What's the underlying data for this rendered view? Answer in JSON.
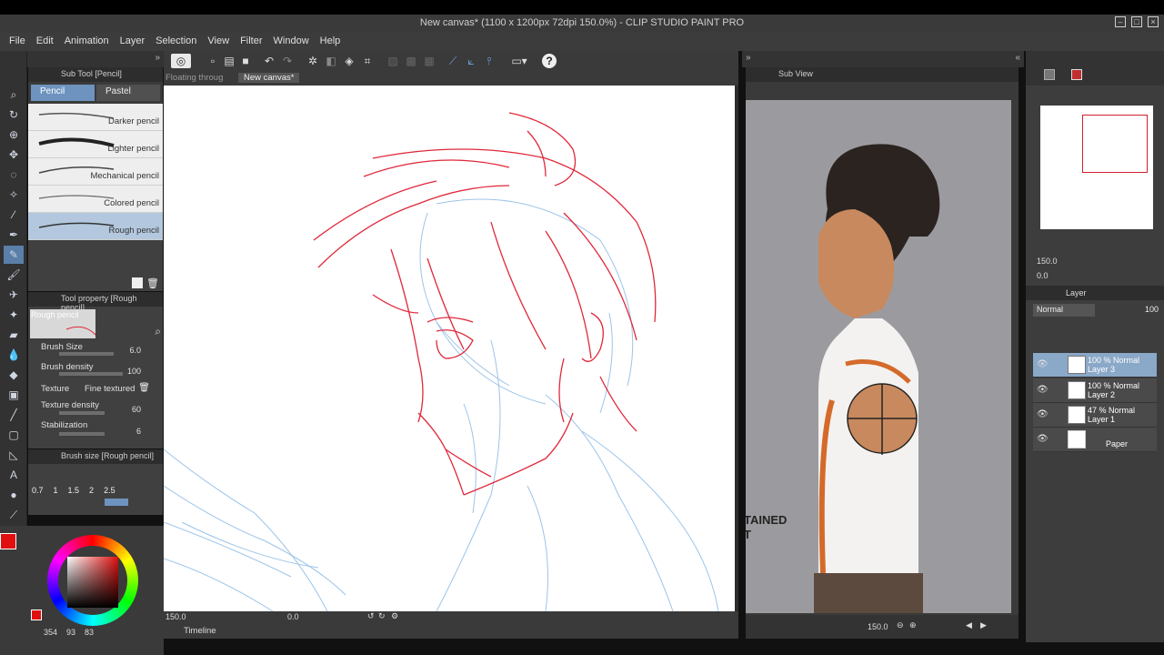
{
  "window": {
    "title": "New canvas* (1100 x 1200px 72dpi 150.0%) - CLIP STUDIO PAINT PRO"
  },
  "menu": [
    "File",
    "Edit",
    "Animation",
    "Layer",
    "Selection",
    "View",
    "Filter",
    "Window",
    "Help"
  ],
  "subtool": {
    "header": "Sub Tool [Pencil]",
    "tabs": [
      "Pencil",
      "Pastel"
    ],
    "brushes": [
      "Darker pencil",
      "Lighter pencil",
      "Mechanical pencil",
      "Colored pencil",
      "Rough pencil"
    ],
    "selected": "Rough pencil"
  },
  "toolprop": {
    "header": "Tool property [Rough pencil]",
    "preset": "Rough pencil",
    "brush_size_label": "Brush Size",
    "brush_size": "6.0",
    "brush_density_label": "Brush density",
    "brush_density": "100",
    "texture_label": "Texture",
    "texture": "Fine textured",
    "texture_density_label": "Texture density",
    "texture_density": "60",
    "stabilization_label": "Stabilization",
    "stabilization": "6"
  },
  "brushsize": {
    "header": "Brush size [Rough pencil]",
    "sizes": [
      "0.7",
      "1",
      "1.5",
      "2",
      "2.5"
    ]
  },
  "color": {
    "primary": "#e01010",
    "secondary": "#ffffff",
    "readout": "354",
    "s": "93",
    "v": "83"
  },
  "canvas": {
    "tabs": [
      "Floating throug",
      "New canvas*"
    ],
    "zoom": "150.0",
    "rotation": "0.0",
    "timeline": "Timeline"
  },
  "subview": {
    "header": "Sub View",
    "zoom": "150.0",
    "text_fragment": "TAINED",
    "text_fragment2": "T"
  },
  "navigator": {
    "zoom": "150.0",
    "rotation": "0.0"
  },
  "layers": {
    "header": "Layer",
    "blend": "Normal",
    "opacity": "100",
    "items": [
      {
        "line1": "100 % Normal",
        "line2": "Layer 3",
        "selected": true
      },
      {
        "line1": "100 % Normal",
        "line2": "Layer 2",
        "selected": false
      },
      {
        "line1": "47 % Normal",
        "line2": "Layer 1",
        "selected": false
      },
      {
        "line1": "",
        "line2": "Paper",
        "selected": false
      }
    ]
  },
  "colors": {
    "accent": "#6e93bf",
    "sketch_red": "#e0283a",
    "sketch_blue": "#9cc4e8"
  }
}
